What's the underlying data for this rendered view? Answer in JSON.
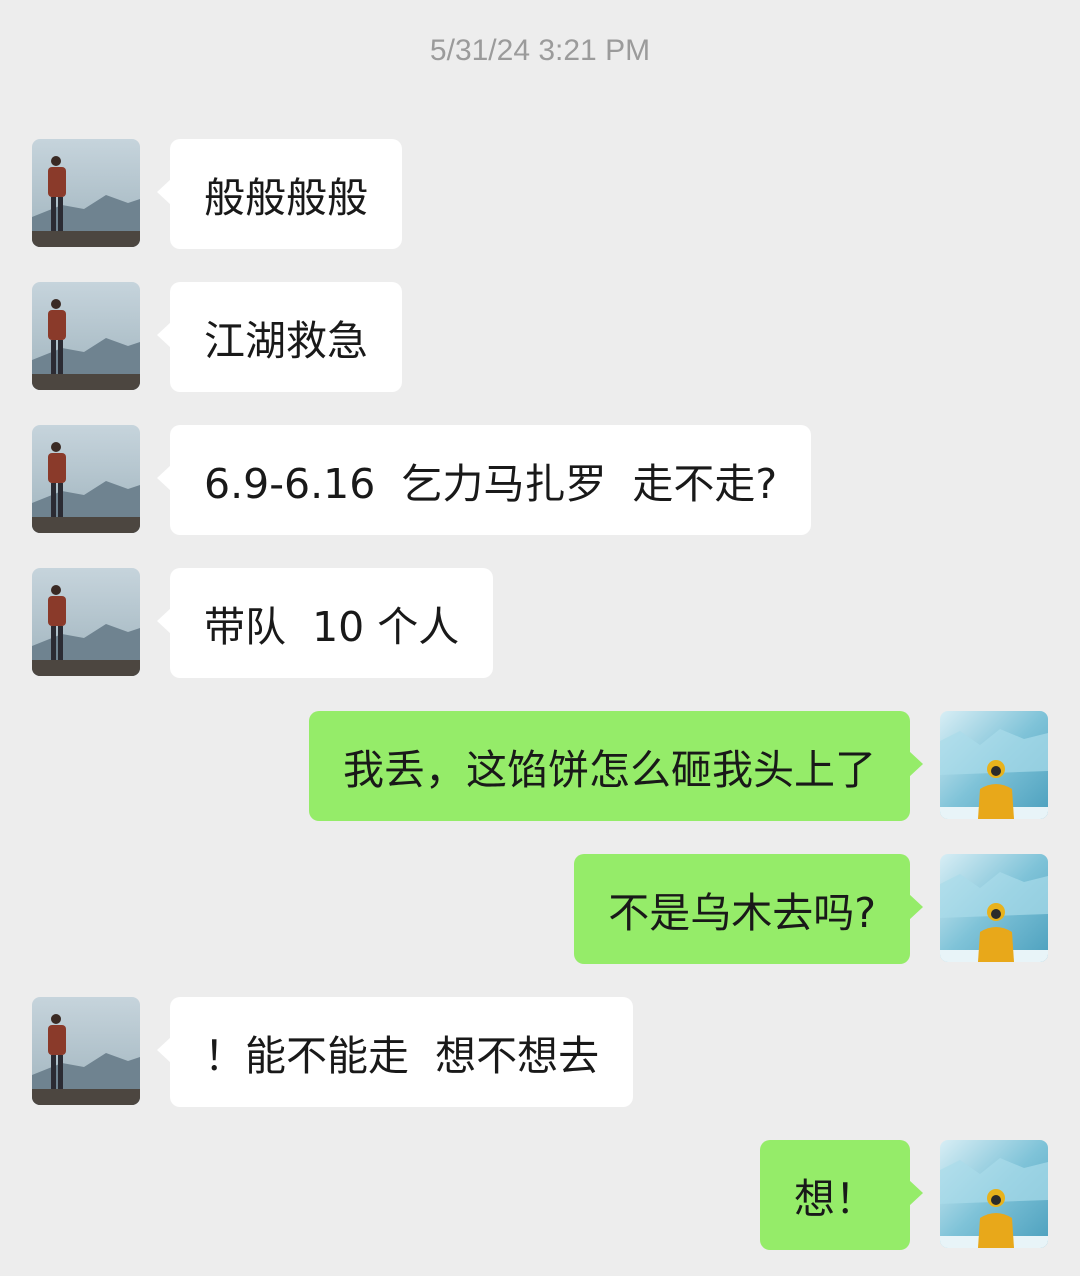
{
  "timestamp": "5/31/24 3:21 PM",
  "messages": [
    {
      "side": "left",
      "text": "般般般般"
    },
    {
      "side": "left",
      "text": "江湖救急"
    },
    {
      "side": "left",
      "text": "6.9-6.16  乞力马扎罗  走不走?"
    },
    {
      "side": "left",
      "text": "带队  10 个人"
    },
    {
      "side": "right",
      "text": "我丢，这馅饼怎么砸我头上了"
    },
    {
      "side": "right",
      "text": "不是乌木去吗?"
    },
    {
      "side": "left",
      "text": "！能不能走  想不想去"
    },
    {
      "side": "right",
      "text": "想！"
    }
  ],
  "colors": {
    "background": "#ededed",
    "incoming_bubble": "#ffffff",
    "outgoing_bubble": "#95ec69",
    "timestamp": "#9b9b9b"
  },
  "icons": {
    "incoming_avatar": "person-on-mountain-avatar",
    "outgoing_avatar": "person-at-glacier-avatar"
  }
}
